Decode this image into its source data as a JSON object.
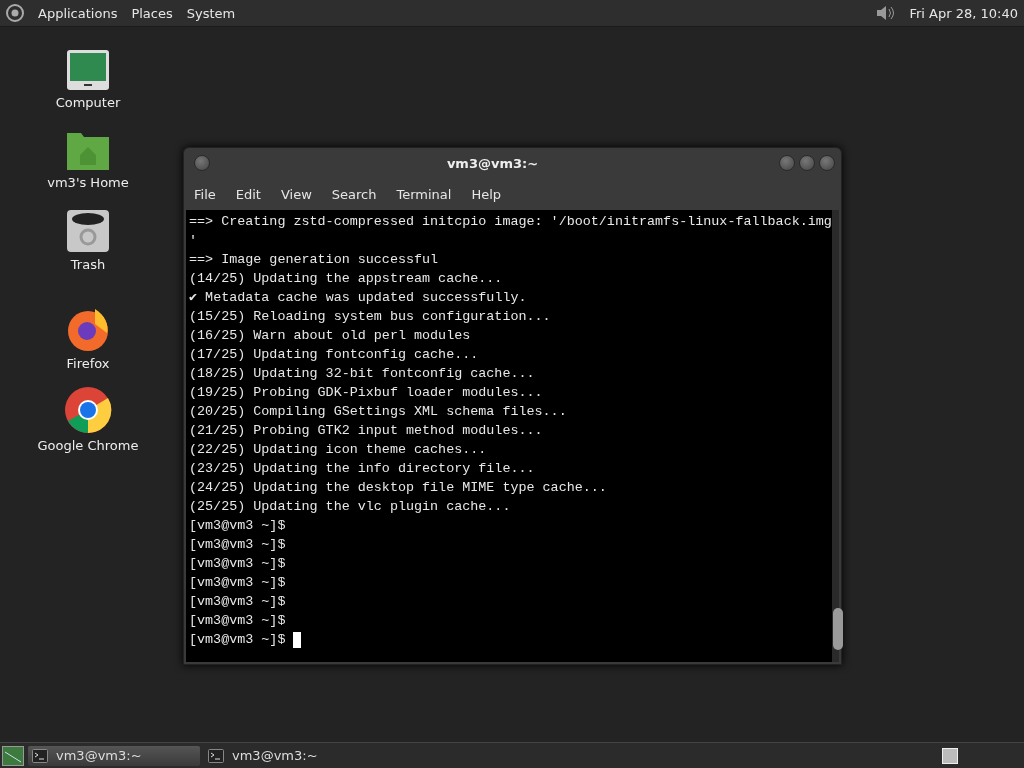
{
  "top_panel": {
    "menus": [
      "Applications",
      "Places",
      "System"
    ],
    "clock": "Fri Apr 28, 10:40"
  },
  "desktop_icons": [
    {
      "kind": "computer",
      "label": "Computer"
    },
    {
      "kind": "home",
      "label": "vm3's Home"
    },
    {
      "kind": "trash",
      "label": "Trash"
    },
    {
      "kind": "firefox",
      "label": "Firefox"
    },
    {
      "kind": "chrome",
      "label": "Google Chrome"
    }
  ],
  "terminal": {
    "title": "vm3@vm3:~",
    "menus": [
      "File",
      "Edit",
      "View",
      "Search",
      "Terminal",
      "Help"
    ],
    "lines": [
      "==> Creating zstd-compressed initcpio image: '/boot/initramfs-linux-fallback.img",
      "'",
      "==> Image generation successful",
      "(14/25) Updating the appstream cache...",
      "✔ Metadata cache was updated successfully.",
      "(15/25) Reloading system bus configuration...",
      "(16/25) Warn about old perl modules",
      "(17/25) Updating fontconfig cache...",
      "(18/25) Updating 32-bit fontconfig cache...",
      "(19/25) Probing GDK-Pixbuf loader modules...",
      "(20/25) Compiling GSettings XML schema files...",
      "(21/25) Probing GTK2 input method modules...",
      "(22/25) Updating icon theme caches...",
      "(23/25) Updating the info directory file...",
      "(24/25) Updating the desktop file MIME type cache...",
      "(25/25) Updating the vlc plugin cache...",
      "[vm3@vm3 ~]$",
      "[vm3@vm3 ~]$",
      "[vm3@vm3 ~]$",
      "[vm3@vm3 ~]$",
      "[vm3@vm3 ~]$",
      "[vm3@vm3 ~]$",
      "[vm3@vm3 ~]$"
    ]
  },
  "taskbar": {
    "tasks": [
      {
        "label": "vm3@vm3:~",
        "selected": true
      },
      {
        "label": "vm3@vm3:~",
        "selected": false
      }
    ]
  }
}
